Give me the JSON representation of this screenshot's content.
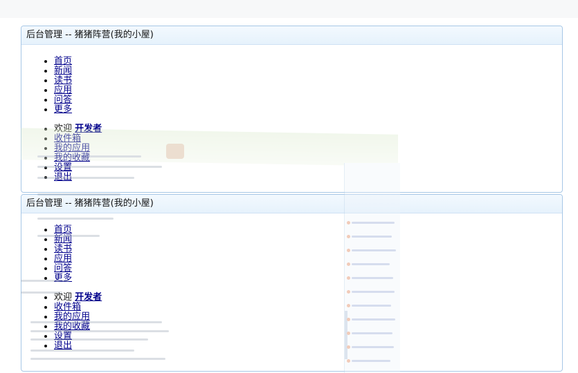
{
  "panels": [
    {
      "title": "后台管理 -- 猪猪阵营(我的小屋)",
      "nav": [
        "首页",
        "新闻",
        "读书",
        "应用",
        "问答",
        "更多"
      ],
      "user_menu": {
        "welcome_prefix": "欢迎",
        "username": "开发者",
        "items": [
          "收件箱",
          "我的应用",
          "我的收藏",
          "设置",
          "退出"
        ]
      }
    },
    {
      "title": "后台管理 -- 猪猪阵营(我的小屋)",
      "nav": [
        "首页",
        "新闻",
        "读书",
        "应用",
        "问答",
        "更多"
      ],
      "user_menu": {
        "welcome_prefix": "欢迎",
        "username": "开发者",
        "items": [
          "收件箱",
          "我的应用",
          "我的收藏",
          "设置",
          "退出"
        ]
      }
    }
  ]
}
